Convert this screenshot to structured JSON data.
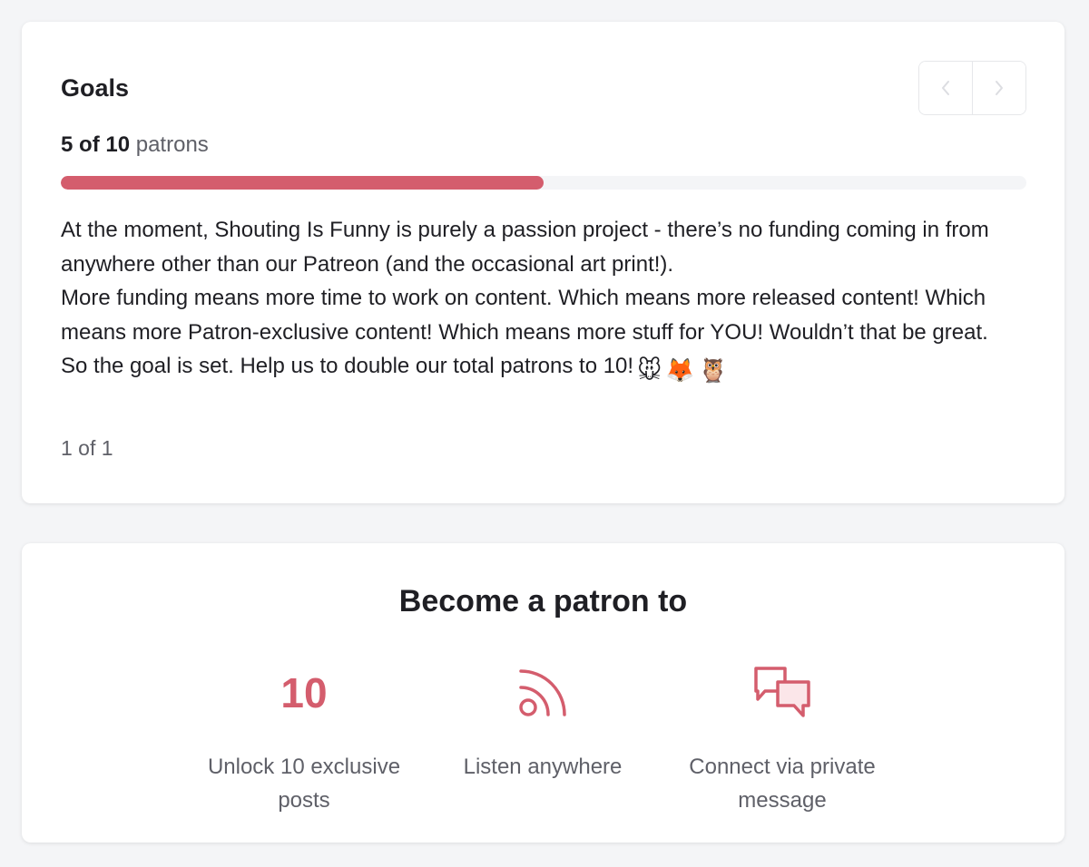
{
  "colors": {
    "accent": "#d45d6d",
    "page_background": "#f4f5f7",
    "card_background": "#ffffff",
    "muted_text": "#5f6068"
  },
  "goals": {
    "title": "Goals",
    "pager": {
      "prev_icon": "chevron-left-icon",
      "next_icon": "chevron-right-icon"
    },
    "progress": {
      "current": "5",
      "of_word": "of",
      "target": "10",
      "unit": "patrons",
      "fraction": 0.5
    },
    "description": [
      "At the moment, Shouting Is Funny is purely a passion project - there’s no funding coming in from anywhere other than our Patreon (and the occasional art print!).",
      "More funding means more time to work on content. Which means more released content! Which means more Patron-exclusive content! Which means more stuff for YOU! Wouldn’t that be great.",
      "So the goal is set. Help us to double our total patrons to 10!"
    ],
    "emojis": [
      "🐭",
      "🦊",
      "🦉"
    ],
    "page_indicator": "1 of 1"
  },
  "become_patron": {
    "title": "Become a patron to",
    "benefits": [
      {
        "visual_text": "10",
        "label": "Unlock 10 exclusive posts"
      },
      {
        "icon": "rss-feed-icon",
        "label": "Listen anywhere"
      },
      {
        "icon": "chat-bubbles-icon",
        "label": "Connect via private message"
      }
    ]
  }
}
